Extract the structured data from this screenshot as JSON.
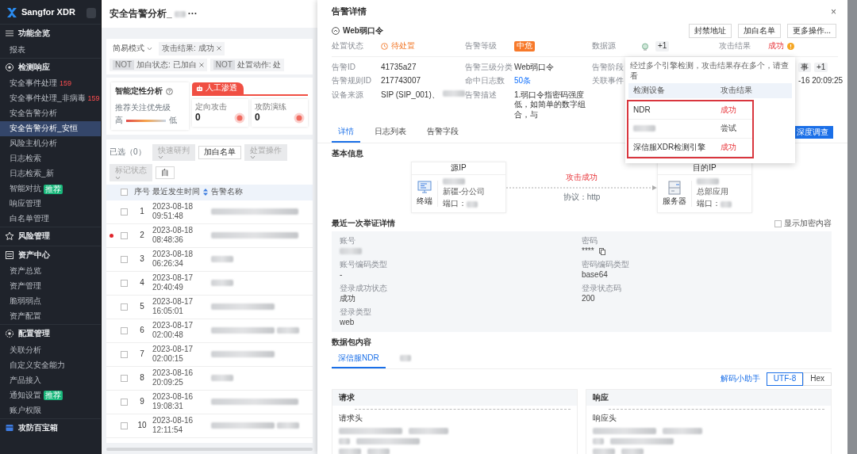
{
  "sidebar": {
    "brand": "Sangfor XDR",
    "groups": [
      {
        "label": "功能全览",
        "items": [
          {
            "label": "报表",
            "selected": false
          }
        ]
      },
      {
        "label": "检测响应",
        "items": [
          {
            "label": "安全事件处理",
            "count": "159",
            "selected": false
          },
          {
            "label": "安全事件处理_非病毒",
            "count": "159",
            "selected": false
          },
          {
            "label": "安全告警分析",
            "selected": false
          },
          {
            "label": "安全告警分析_安恒",
            "selected": true
          },
          {
            "label": "风险主机分析",
            "selected": false
          },
          {
            "label": "日志检索",
            "selected": false
          },
          {
            "label": "日志检索_新",
            "selected": false
          },
          {
            "label": "智能对抗",
            "tag": "推荐",
            "selected": false
          },
          {
            "label": "响应管理",
            "selected": false
          },
          {
            "label": "白名单管理",
            "selected": false
          }
        ]
      },
      {
        "label": "风险管理"
      },
      {
        "label": "资产中心",
        "items": [
          {
            "label": "资产总览",
            "selected": false
          },
          {
            "label": "资产管理",
            "selected": false
          },
          {
            "label": "脆弱弱点",
            "selected": false
          },
          {
            "label": "资产配置",
            "selected": false
          }
        ]
      },
      {
        "label": "配置管理",
        "items": [
          {
            "label": "关联分析",
            "selected": false
          },
          {
            "label": "自定义安全能力",
            "selected": false
          },
          {
            "label": "产品接入",
            "selected": false
          },
          {
            "label": "通知设置",
            "tag": "推荐",
            "selected": false
          },
          {
            "label": "账户权限",
            "selected": false
          }
        ]
      },
      {
        "label": "攻防百宝箱"
      }
    ]
  },
  "page": {
    "title": "安全告警分析_",
    "more": "···",
    "mode": "简易模式",
    "filters": [
      {
        "negated": false,
        "text": "攻击结果: 成功",
        "removable": true
      },
      {
        "negated": true,
        "not_label": "NOT",
        "text": "加白状态: 已加白",
        "removable": true
      },
      {
        "negated": true,
        "not_label": "NOT",
        "text": "处置动作: 处",
        "removable": false
      }
    ],
    "analysis": {
      "title": "智能定性分析",
      "priority_label": "推荐关注优先级",
      "high": "高",
      "low": "低"
    },
    "manual": {
      "label": "人工渗透",
      "stats": [
        {
          "label": "定向攻击",
          "value": "0"
        },
        {
          "label": "攻防演练",
          "value": "0"
        }
      ]
    },
    "toolbar": {
      "selected_count": "已选（0）",
      "buttons": [
        {
          "label": "快速研判",
          "dropdown": true,
          "disabled": true
        },
        {
          "label": "加白名单",
          "dropdown": false,
          "disabled": false
        },
        {
          "label": "处置操作",
          "dropdown": true,
          "disabled": true
        },
        {
          "label": "标记状态",
          "dropdown": true,
          "disabled": true
        },
        {
          "label": "自",
          "dropdown": false,
          "disabled": false
        }
      ]
    },
    "table": {
      "select_all": {
        "checked": false
      },
      "columns": [
        "序号",
        "最近发生时间",
        "告警名称"
      ],
      "rows": [
        {
          "seq": "1",
          "date": "2023-08-18",
          "time": "09:51:48",
          "flagged": false,
          "checked": false
        },
        {
          "seq": "2",
          "date": "2023-08-18",
          "time": "08:48:36",
          "flagged": true,
          "checked": false
        },
        {
          "seq": "3",
          "date": "2023-08-18",
          "time": "06:26:34",
          "flagged": false,
          "checked": false
        },
        {
          "seq": "4",
          "date": "2023-08-17",
          "time": "20:40:49",
          "flagged": false,
          "checked": false
        },
        {
          "seq": "5",
          "date": "2023-08-17",
          "time": "16:05:01",
          "flagged": false,
          "checked": false
        },
        {
          "seq": "6",
          "date": "2023-08-17",
          "time": "02:00:48",
          "flagged": false,
          "checked": false
        },
        {
          "seq": "7",
          "date": "2023-08-17",
          "time": "02:00:15",
          "flagged": false,
          "checked": false
        },
        {
          "seq": "8",
          "date": "2023-08-16",
          "time": "20:09:25",
          "flagged": false,
          "checked": false
        },
        {
          "seq": "9",
          "date": "2023-08-16",
          "time": "19:08:31",
          "flagged": false,
          "checked": false
        },
        {
          "seq": "10",
          "date": "2023-08-16",
          "time": "12:11:54",
          "flagged": false,
          "checked": false
        }
      ]
    }
  },
  "drawer": {
    "title": "告警详情",
    "close": "×",
    "alert_name": "Web弱口令",
    "actions": [
      "封禁地址",
      "加白名单",
      "更多操作..."
    ],
    "status": {
      "label": "处置状态",
      "value": "待处置"
    },
    "level": {
      "label": "告警等级",
      "value": "中危"
    },
    "source": {
      "label": "数据源",
      "extra": "+1"
    },
    "result": {
      "label": "攻击结果",
      "value": "成功"
    },
    "fields": [
      {
        "label": "告警ID",
        "value": "41735a27"
      },
      {
        "label": "告警三级分类",
        "value": "Web弱口令"
      },
      {
        "label": "告警阶段"
      },
      {
        "tag": "事",
        "extra": "+1"
      },
      {
        "label": "告警规则ID",
        "value": "217743007"
      },
      {
        "label": "命中日志数",
        "value": "50条",
        "link": true
      },
      {
        "label": "关联事件"
      },
      {
        "value": "-16 20:09:25"
      },
      {
        "label": "设备来源",
        "value": "SIP (SIP_001)、",
        "redacted_tail": true
      },
      {
        "label": "告警描述",
        "value": "1.弱口令指密码强度低，如简单的数字组合，与"
      }
    ],
    "popup": {
      "note": "经过多个引擎检测，攻击结果存在多个，请查看",
      "columns": [
        "检测设备",
        "攻击结果"
      ],
      "rows": [
        {
          "kind": "text",
          "device": "NDR",
          "result": "成功",
          "success": true
        },
        {
          "kind": "redacted",
          "result": "尝试",
          "success": false
        },
        {
          "kind": "text",
          "device": "深信服XDR检测引擎",
          "result": "成功",
          "success": true
        }
      ]
    },
    "tabs": [
      {
        "label": "详情",
        "selected": true
      },
      {
        "label": "日志列表",
        "selected": false
      },
      {
        "label": "告警字段",
        "selected": false
      }
    ],
    "investigate": "深度调查",
    "basic": {
      "title": "基本信息",
      "src": {
        "header": "源IP",
        "role": "终端",
        "location": "新疆-分公司",
        "port_label": "端口："
      },
      "dst": {
        "header": "目的IP",
        "role": "服务器",
        "location": "总部应用",
        "port_label": "端口："
      },
      "outcome": "攻击成功",
      "protocol": "协议：http"
    },
    "evidence": {
      "title": "最近一次举证详情",
      "toggle": {
        "label": "显示加密内容",
        "checked": false
      },
      "fields": [
        {
          "label": "账号",
          "kind": "redacted",
          "copyable": false
        },
        {
          "label": "密码",
          "kind": "text",
          "value": "****",
          "copyable": true
        },
        {
          "label": "账号编码类型",
          "kind": "text",
          "value": "-",
          "copyable": false
        },
        {
          "label": "密码编码类型",
          "kind": "text",
          "value": "base64",
          "copyable": false
        },
        {
          "label": "登录成功状态",
          "kind": "text",
          "value": "成功",
          "copyable": false
        },
        {
          "label": "登录状态码",
          "kind": "text",
          "value": "200",
          "copyable": false
        },
        {
          "label": "登录类型",
          "kind": "text",
          "value": "web",
          "copyable": false
        }
      ]
    },
    "packet": {
      "title": "数据包内容",
      "tabs": [
        {
          "kind": "text",
          "label": "深信服NDR",
          "selected": true
        },
        {
          "kind": "redacted",
          "selected": false
        }
      ],
      "decoder": "解码小助手",
      "encodings": [
        {
          "label": "UTF-8",
          "selected": true
        },
        {
          "label": "Hex",
          "selected": false
        }
      ],
      "panels": [
        {
          "title": "请求",
          "header_label": "请求头"
        },
        {
          "title": "响应",
          "header_label": "响应头"
        }
      ]
    }
  }
}
